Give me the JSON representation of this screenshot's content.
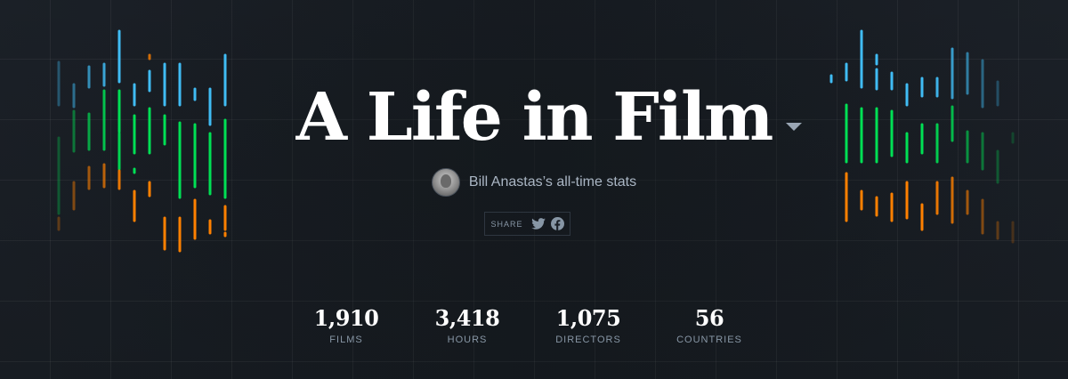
{
  "header": {
    "title": "A Life in Film",
    "byline": "Bill Anastas’s all-time stats",
    "share_label": "SHARE"
  },
  "stats": [
    {
      "value": "1,910",
      "label": "FILMS"
    },
    {
      "value": "3,418",
      "label": "HOURS"
    },
    {
      "value": "1,075",
      "label": "DIRECTORS"
    },
    {
      "value": "56",
      "label": "COUNTRIES"
    }
  ],
  "icons": {
    "title_caret": "chevron-down-icon",
    "avatar": "user-avatar",
    "twitter": "twitter-icon",
    "facebook": "facebook-icon"
  },
  "colors": {
    "background": "#14181c",
    "blue": "#40bcf4",
    "green": "#00e054",
    "orange": "#ff8000",
    "text_muted": "#8796a5"
  }
}
